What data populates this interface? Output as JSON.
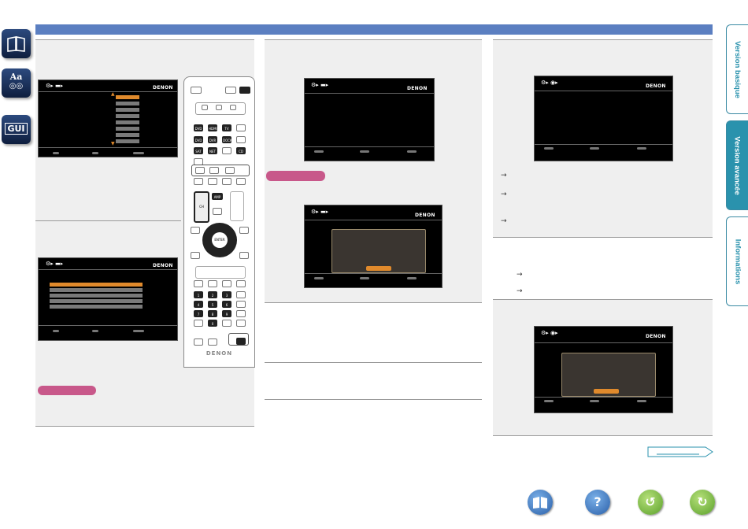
{
  "brand": "DENON",
  "remote": {
    "brand": "DENON",
    "keys_top": [
      "DVD",
      "HDMI",
      "TV",
      "",
      "DVD",
      "DVR",
      "DOCK",
      "",
      "SAT",
      "NET",
      "",
      "CD"
    ],
    "num_keys": [
      "1",
      "2",
      "3",
      "4",
      "5",
      "6",
      "7",
      "8",
      "9",
      "",
      "0",
      ""
    ],
    "ch_label": "CH",
    "amp_label": "AMP",
    "enter_label": "ENTER"
  },
  "side_icons": {
    "book": "book-icon",
    "dict_letters": "Aa",
    "gui": "GUI"
  },
  "tabs": [
    {
      "label": "Version basique",
      "active": false
    },
    {
      "label": "Version avancée",
      "active": true
    },
    {
      "label": "Informations",
      "active": false
    }
  ],
  "colors": {
    "topbar": "#5b7fc1",
    "accent_orange": "#e08a2c",
    "pill_pink": "#c8588a",
    "tab_teal": "#2a92ad"
  },
  "nav_buttons": [
    "book-icon",
    "help-icon",
    "back-icon",
    "forward-icon"
  ]
}
